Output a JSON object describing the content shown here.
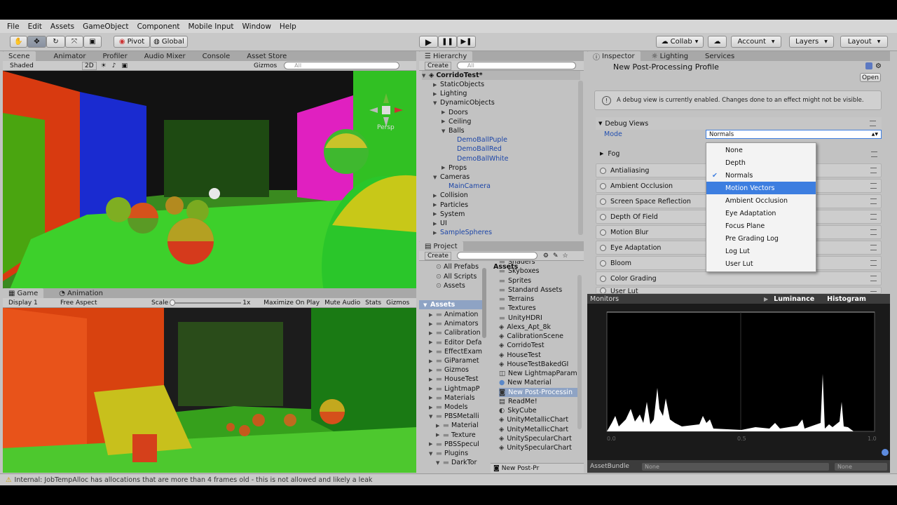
{
  "menu": [
    "File",
    "Edit",
    "Assets",
    "GameObject",
    "Component",
    "Mobile Input",
    "Window",
    "Help"
  ],
  "toolbar": {
    "pivot": "Pivot",
    "global": "Global",
    "collab": "Collab",
    "account": "Account",
    "layers": "Layers",
    "layout": "Layout"
  },
  "scene": {
    "tabs": [
      "Scene",
      "Animator",
      "Profiler",
      "Audio Mixer",
      "Console",
      "Asset Store"
    ],
    "shading": "Shaded",
    "mode2d": "2D",
    "gizmos": "Gizmos",
    "search_placeholder": "All",
    "persp": "Persp"
  },
  "game": {
    "tabs": [
      "Game",
      "Animation"
    ],
    "display": "Display 1",
    "aspect": "Free Aspect",
    "scale_label": "Scale",
    "scale_value": "1x",
    "maximize": "Maximize On Play",
    "mute": "Mute Audio",
    "stats": "Stats",
    "gizmos": "Gizmos"
  },
  "hierarchy": {
    "tab": "Hierarchy",
    "create": "Create",
    "search_placeholder": "All",
    "scene_name": "CorridoTest*",
    "items": [
      {
        "label": "StaticObjects",
        "indent": 1,
        "arrow": "▶",
        "color": "normal"
      },
      {
        "label": "Lighting",
        "indent": 1,
        "arrow": "▶",
        "color": "normal"
      },
      {
        "label": "DynamicObjects",
        "indent": 1,
        "arrow": "▼",
        "color": "normal"
      },
      {
        "label": "Doors",
        "indent": 2,
        "arrow": "▶",
        "color": "normal"
      },
      {
        "label": "Ceiling",
        "indent": 2,
        "arrow": "▶",
        "color": "normal"
      },
      {
        "label": "Balls",
        "indent": 2,
        "arrow": "▼",
        "color": "normal"
      },
      {
        "label": "DemoBallPuple",
        "indent": 3,
        "arrow": "",
        "color": "blue"
      },
      {
        "label": "DemoBallRed",
        "indent": 3,
        "arrow": "",
        "color": "blue"
      },
      {
        "label": "DemoBallWhite",
        "indent": 3,
        "arrow": "",
        "color": "blue"
      },
      {
        "label": "Props",
        "indent": 2,
        "arrow": "▶",
        "color": "normal"
      },
      {
        "label": "Cameras",
        "indent": 1,
        "arrow": "▼",
        "color": "normal"
      },
      {
        "label": "MainCamera",
        "indent": 2,
        "arrow": "",
        "color": "blue"
      },
      {
        "label": "Collision",
        "indent": 1,
        "arrow": "▶",
        "color": "normal"
      },
      {
        "label": "Particles",
        "indent": 1,
        "arrow": "▶",
        "color": "normal"
      },
      {
        "label": "System",
        "indent": 1,
        "arrow": "▶",
        "color": "normal"
      },
      {
        "label": "UI",
        "indent": 1,
        "arrow": "▶",
        "color": "normal"
      },
      {
        "label": "SampleSpheres",
        "indent": 1,
        "arrow": "▶",
        "color": "blue"
      }
    ]
  },
  "project": {
    "tab": "Project",
    "create": "Create",
    "favorites": [
      "All Prefabs",
      "All Scripts",
      "Assets"
    ],
    "root": "Assets",
    "folders": [
      "Animation",
      "Animators",
      "Calibration",
      "Editor Defa",
      "EffectExam",
      "GiParamet",
      "Gizmos",
      "HouseTest",
      "LightmapP",
      "Materials",
      "Models",
      "PBSMetalli",
      "Material",
      "Texture",
      "PBSSpecul",
      "Plugins",
      "DarkTor"
    ],
    "breadcrumb": "Assets",
    "assets": [
      "Shaders",
      "Skyboxes",
      "Sprites",
      "Standard Assets",
      "Terrains",
      "Textures",
      "UnityHDRI",
      "Alexs_Apt_8k",
      "CalibrationScene",
      "CorridoTest",
      "HouseTest",
      "HouseTestBakedGI",
      "New LightmapParam",
      "New Material",
      "New Post-Processin",
      "ReadMe!",
      "SkyCube",
      "UnityMetallicChart",
      "UnityMetallicChart",
      "UnitySpecularChart",
      "UnitySpecularChart"
    ],
    "footer": "New Post-Pr"
  },
  "inspector": {
    "tabs": [
      "Inspector",
      "Lighting",
      "Services"
    ],
    "title": "New Post-Processing Profile",
    "open": "Open",
    "warning": "A debug view is currently enabled. Changes done to an effect might not be visible.",
    "debug_views": "Debug Views",
    "mode_label": "Mode",
    "mode_value": "Normals",
    "effects": [
      "Fog",
      "Antialiasing",
      "Ambient Occlusion",
      "Screen Space Reflection",
      "Depth Of Field",
      "Motion Blur",
      "Eye Adaptation",
      "Bloom",
      "Color Grading",
      "User Lut"
    ]
  },
  "dropdown": {
    "options": [
      "None",
      "Depth",
      "Normals",
      "Motion Vectors",
      "Ambient Occlusion",
      "Eye Adaptation",
      "Focus Plane",
      "Pre Grading Log",
      "Log Lut",
      "User Lut"
    ],
    "checked": "Normals",
    "highlighted": "Motion Vectors"
  },
  "monitors": {
    "tab": "Monitors",
    "luminance": "Luminance",
    "histogram": "Histogram",
    "ticks": [
      "0.0",
      "0.5",
      "1.0"
    ],
    "asset_bundle": "AssetBundle",
    "none1": "None",
    "none2": "None"
  },
  "status": "Internal: JobTempAlloc has allocations that are more than 4 frames old - this is not allowed and likely a leak",
  "colors": {
    "accent": "#3d7ee0",
    "selection": "#8ea3c4",
    "link": "#1d46a8"
  }
}
